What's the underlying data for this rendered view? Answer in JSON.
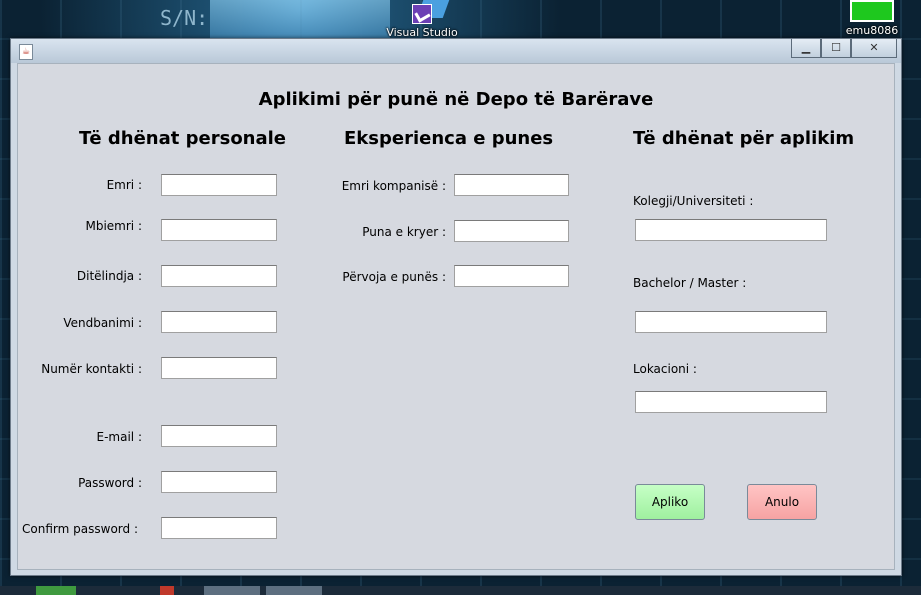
{
  "desktop": {
    "partial_text": "S/N:",
    "icons": [
      {
        "label": "Visual Studio",
        "icon": "visual-studio-icon"
      },
      {
        "label": "emu8086",
        "icon": "emu8086-icon"
      }
    ]
  },
  "window": {
    "icon": "java-icon",
    "controls": {
      "minimize": "▁",
      "maximize": "☐",
      "close": "✕"
    }
  },
  "form": {
    "title": "Aplikimi për punë në Depo të Barërave",
    "personal": {
      "heading": "Të dhënat personale",
      "fields": [
        {
          "label": "Emri :",
          "value": ""
        },
        {
          "label": "Mbiemri :",
          "value": ""
        },
        {
          "label": "Ditëlindja :",
          "value": ""
        },
        {
          "label": "Vendbanimi :",
          "value": ""
        },
        {
          "label": "Numër kontakti :",
          "value": ""
        },
        {
          "label": "E-mail :",
          "value": ""
        },
        {
          "label": "Password :",
          "value": ""
        },
        {
          "label": "Confirm password :",
          "value": ""
        }
      ]
    },
    "experience": {
      "heading": "Eksperienca e punes",
      "fields": [
        {
          "label": "Emri kompanisë :",
          "value": ""
        },
        {
          "label": "Puna e kryer :",
          "value": ""
        },
        {
          "label": "Përvoja e punës :",
          "value": ""
        }
      ]
    },
    "application": {
      "heading": "Të dhënat për aplikim",
      "fields": [
        {
          "label": "Kolegji/Universiteti :",
          "value": ""
        },
        {
          "label": "Bachelor / Master :",
          "value": ""
        },
        {
          "label": "Lokacioni :",
          "value": ""
        }
      ]
    },
    "buttons": {
      "apply": "Apliko",
      "cancel": "Anulo"
    }
  },
  "colors": {
    "apply_button": "#9ff09f",
    "cancel_button": "#f6a3a3",
    "panel_background": "#d6d9e0"
  }
}
